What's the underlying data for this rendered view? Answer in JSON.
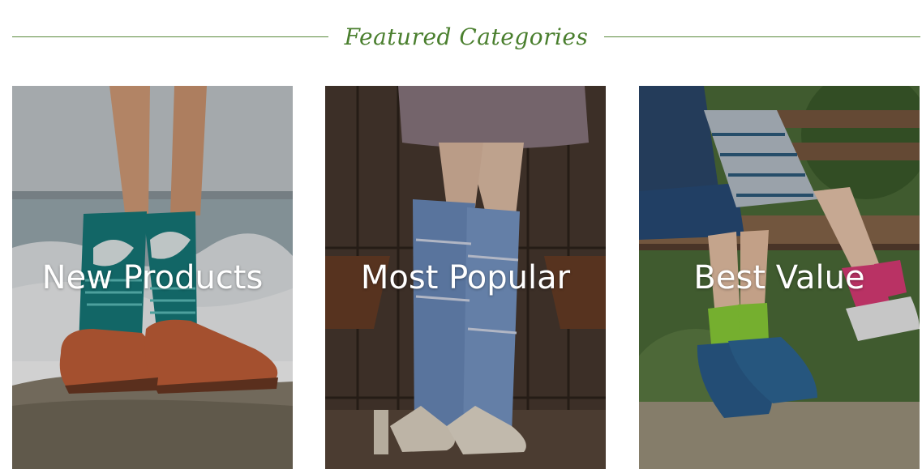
{
  "section": {
    "heading": "Featured Categories",
    "accent_color": "#4a7f2e"
  },
  "categories": [
    {
      "label": "New Products",
      "image": "wave-socks-clogs-photo"
    },
    {
      "label": "Most Popular",
      "image": "knee-socks-heels-photo"
    },
    {
      "label": "Best Value",
      "image": "kids-socks-bench-photo"
    }
  ]
}
